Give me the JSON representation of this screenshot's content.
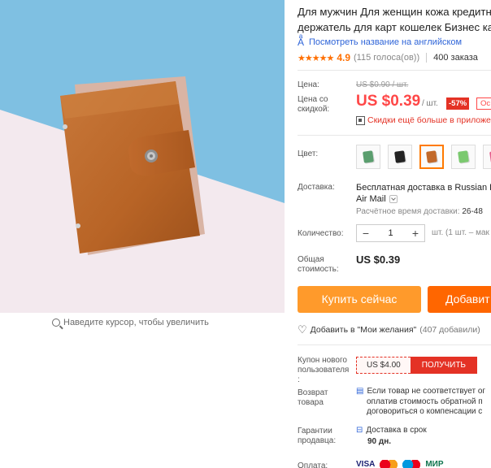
{
  "product": {
    "title_line1": "Для мужчин Для женщин кожа кредитн",
    "title_line2": "держатель для карт кошелек Бизнес кар",
    "translate_link": "Посмотреть название на английском",
    "rating_stars": "★★★★★",
    "rating_value": "4.9",
    "votes": "(115 голоса(ов))",
    "orders": "400 заказа"
  },
  "price": {
    "label_price": "Цена:",
    "old_price": "US $0.90 / шт.",
    "label_discount_1": "Цена со",
    "label_discount_2": "скидкой:",
    "current_price": "US $0.39",
    "per_unit": "/ шт.",
    "discount_badge": "-57%",
    "coupon_mini": "Ос",
    "app_promo": "Скидки ещё больше в приложе"
  },
  "color": {
    "label": "Цвет:",
    "swatches": [
      {
        "name": "green",
        "color": "#5a9e6e"
      },
      {
        "name": "black",
        "color": "#222222"
      },
      {
        "name": "brown",
        "color": "#c2692a",
        "selected": true
      },
      {
        "name": "light-green",
        "color": "#7bc96f"
      },
      {
        "name": "pink",
        "color": "#e55a8a"
      }
    ]
  },
  "shipping": {
    "label": "Доставка:",
    "line1": "Бесплатная доставка в Russian F",
    "line2": "Air Mail",
    "time_label": "Расчётное время доставки:",
    "time_value": "26-48"
  },
  "quantity": {
    "label": "Количество:",
    "minus": "−",
    "value": "1",
    "plus": "+",
    "note": "шт. (1 шт. – мак"
  },
  "total": {
    "label_1": "Общая",
    "label_2": "стоимость:",
    "value": "US $0.39"
  },
  "actions": {
    "buy_now": "Купить сейчас",
    "add_to_cart": "Добавит",
    "wishlist": "Добавить в \"Мои желания\"",
    "wishlist_count": "(407 добавили)"
  },
  "coupon": {
    "label_1": "Купон нового",
    "label_2": "пользователя",
    "label_3": ":",
    "value": "US $4.00",
    "get": "ПОЛУЧИТЬ"
  },
  "returns": {
    "label_1": "Возврат",
    "label_2": "товара",
    "line1": "Если товар не соответствует ог",
    "line2": "оплатив стоимость обратной п",
    "line3": "договориться о компенсации с"
  },
  "guarantee": {
    "label_1": "Гарантии",
    "label_2": "продавца:",
    "line1": "Доставка в срок",
    "line2": "90 дн."
  },
  "payment": {
    "label": "Оплата:",
    "visa": "VISA",
    "mir": "МИР"
  },
  "zoom_hint": "Наведите курсор, чтобы увеличить"
}
